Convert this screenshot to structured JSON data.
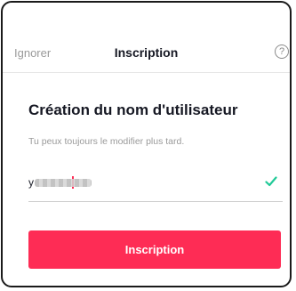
{
  "header": {
    "skip_label": "Ignorer",
    "title": "Inscription",
    "help_icon": "question-circle-icon",
    "help_glyph": "?"
  },
  "main": {
    "heading": "Création du nom d'utilisateur",
    "subtext": "Tu peux toujours le modifier plus tard.",
    "username_field": {
      "visible_prefix": "y",
      "status_icon": "checkmark-icon"
    },
    "submit_label": "Inscription"
  },
  "colors": {
    "accent": "#fe2c55",
    "valid": "#20c997",
    "text_primary": "#161823",
    "text_secondary": "#9a9a9a"
  }
}
